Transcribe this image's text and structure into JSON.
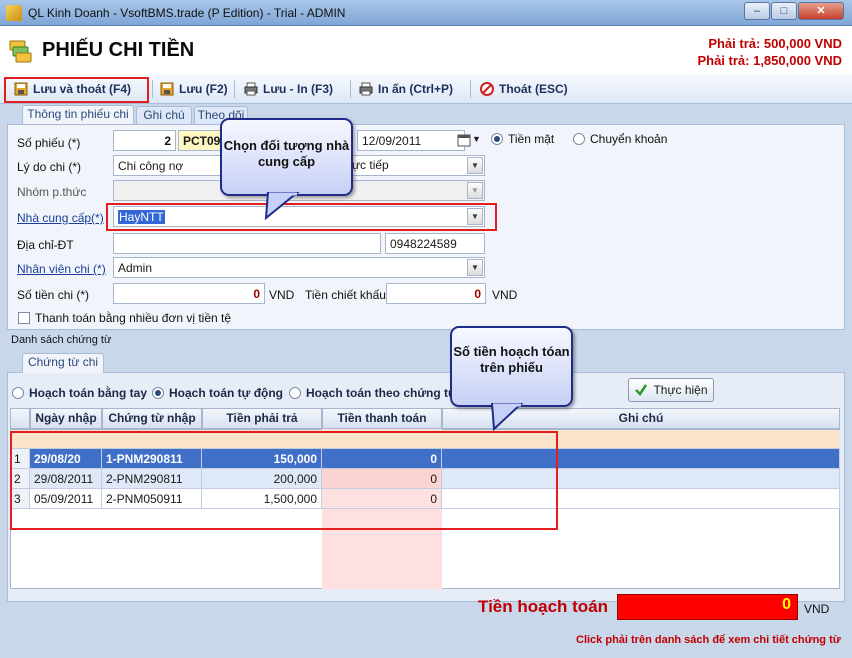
{
  "window": {
    "title": "QL Kinh Doanh - VsoftBMS.trade (P Edition) - Trial - ADMIN",
    "minimize": "–",
    "maximize": "□",
    "close": "✕"
  },
  "header": {
    "title": "PHIẾU CHI TIỀN",
    "payable_1": "Phải trả: 500,000 VND",
    "payable_2": "Phải trả: 1,850,000 VND"
  },
  "toolbar": {
    "save_exit": "Lưu và thoát (F4)",
    "save": "Lưu (F2)",
    "save_print": "Lưu - In (F3)",
    "print": "In ấn (Ctrl+P)",
    "exit": "Thoát (ESC)"
  },
  "tabs": [
    "Thông tin phiếu chi",
    "Ghi chú",
    "Theo dõi"
  ],
  "form": {
    "so_phieu_label": "Số phiếu (*)",
    "so_phieu_num": "2",
    "so_phieu_prefix": "PCT09",
    "date": "12/09/2011",
    "tien_mat": "Tiền mặt",
    "chuyen_khoan": "Chuyển khoản",
    "ly_do_label": "Lý do chi (*)",
    "ly_do_value": "Chi công nợ",
    "ly_do_value2": "ực tiếp",
    "nhom_label": "Nhóm p.thức",
    "ncc_label": "Nhà cung cấp(*)",
    "ncc_value": "HayNTT",
    "dia_chi_label": "Địa chỉ-ĐT",
    "dia_chi_value": "",
    "phone": "0948224589",
    "nhan_vien_label": "Nhân viên chi (*)",
    "nhan_vien_value": "Admin",
    "so_tien_label": "Số tiền chi (*)",
    "so_tien_value": "0",
    "vnd": "VND",
    "chiet_khau_label": "Tiền chiết khấu",
    "chiet_khau_value": "0",
    "multi_currency": "Thanh toán bằng nhiều đơn vị tiền tệ"
  },
  "callouts": {
    "supplier": "Chọn đối tượng nhà cung cấp",
    "amount": "Số tiền hoạch tóan trên phiếu"
  },
  "docs": {
    "section_label": "Danh sách chứng từ",
    "tab": "Chứng từ chi",
    "mode_manual": "Hoạch toán bằng tay",
    "mode_auto": "Hoạch toán tự động",
    "mode_by_doc": "Hoạch toán theo chứng từ",
    "execute": "Thực hiện"
  },
  "grid": {
    "columns": [
      "Ngày nhập",
      "Chứng từ nhập",
      "Tiền phải trả",
      "Tiền thanh toán",
      "Ghi chú"
    ],
    "rows": [
      {
        "idx": "1",
        "date": "29/08/20",
        "doc": "1-PNM290811",
        "due": "150,000",
        "paid": "0",
        "note": ""
      },
      {
        "idx": "2",
        "date": "29/08/2011",
        "doc": "2-PNM290811",
        "due": "200,000",
        "paid": "0",
        "note": ""
      },
      {
        "idx": "3",
        "date": "05/09/2011",
        "doc": "2-PNM050911",
        "due": "1,500,000",
        "paid": "0",
        "note": ""
      }
    ]
  },
  "footer": {
    "total_label": "Tiền hoạch toán",
    "total_value": "0",
    "currency": "VND",
    "hint": "Click phải trên danh sách để xem chi tiết chứng từ"
  },
  "icons": {
    "app": "app-icon",
    "header": "money-icon",
    "save_exit": "floppy-icon",
    "save": "floppy-icon",
    "save_print": "printer-icon",
    "print": "printer-icon",
    "exit": "no-entry-icon",
    "execute": "checkmark-icon"
  },
  "colors": {
    "payable": "#c00000",
    "highlight": "#e21e1e",
    "selected_row": "#3f6fc7",
    "total_box": "#ff0000"
  }
}
